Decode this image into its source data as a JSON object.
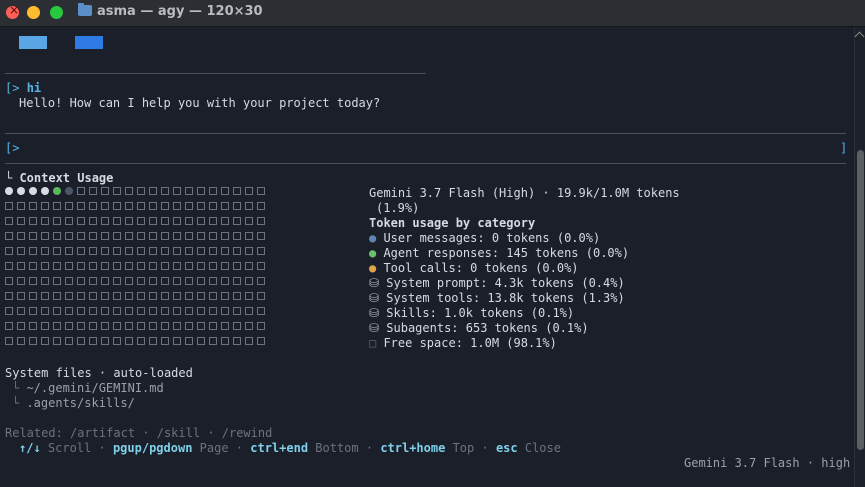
{
  "window": {
    "title": "asma — agy — 120×30"
  },
  "conversation": {
    "prompt_marker": "[>",
    "user_message": "hi",
    "assistant_message": "Hello! How can I help you with your project today?",
    "input_marker": "[>",
    "input_end_marker": "]"
  },
  "context": {
    "heading": "Context Usage",
    "model_line": "Gemini 3.7 Flash (High) · 19.9k/1.0M tokens",
    "model_line_pct": "(1.9%)",
    "category_heading": "Token usage by category",
    "categories": [
      {
        "icon": "circle-blue-icon",
        "label": "User messages: 0 tokens (0.0%)"
      },
      {
        "icon": "circle-green-icon",
        "label": "Agent responses: 145 tokens (0.0%)"
      },
      {
        "icon": "circle-orange-icon",
        "label": "Tool calls: 0 tokens (0.0%)"
      },
      {
        "icon": "database-icon",
        "label": "System prompt: 4.3k tokens (0.4%)"
      },
      {
        "icon": "database-icon",
        "label": "System tools: 13.8k tokens (1.3%)"
      },
      {
        "icon": "database-icon",
        "label": "Skills: 1.0k tokens (0.1%)"
      },
      {
        "icon": "database-icon",
        "label": "Subagents: 653 tokens (0.1%)"
      },
      {
        "icon": "square-empty-icon",
        "label": "Free space: 1.0M (98.1%)"
      }
    ],
    "grid": {
      "columns": 22,
      "rows": 11,
      "filled_cells": 4,
      "green_cells": 1,
      "dark_cells": 1
    }
  },
  "system_files": {
    "heading": "System files · auto-loaded",
    "items": [
      "~/.gemini/GEMINI.md",
      ".agents/skills/"
    ]
  },
  "footer": {
    "related": "Related: /artifact · /skill · /rewind",
    "shortcuts": [
      {
        "key": "↑/↓",
        "action": "Scroll"
      },
      {
        "key": "pgup/pgdown",
        "action": "Page"
      },
      {
        "key": "ctrl+end",
        "action": "Bottom"
      },
      {
        "key": "ctrl+home",
        "action": "Top"
      },
      {
        "key": "esc",
        "action": "Close"
      }
    ],
    "status": "Gemini 3.7 Flash · high"
  },
  "colors": {
    "background": "#1b1f2a",
    "accent": "#56b6e6",
    "key": "#7fd0ea"
  }
}
